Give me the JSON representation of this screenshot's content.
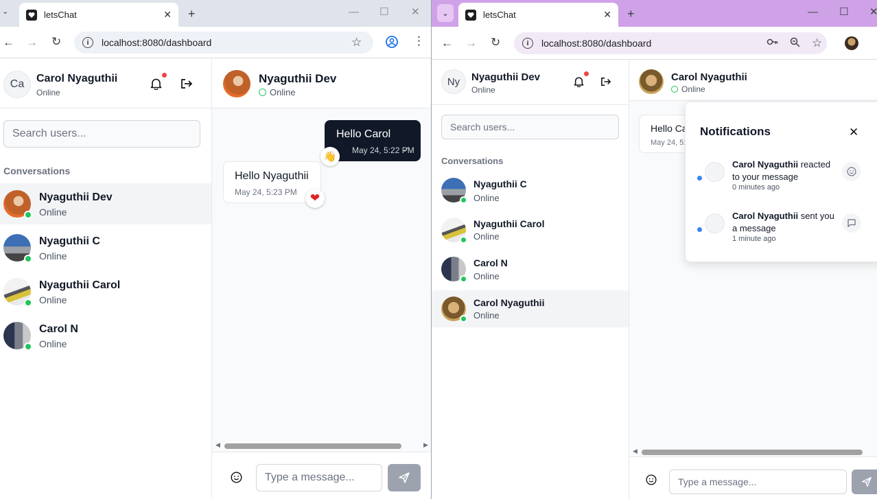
{
  "left_window": {
    "tab_title": "letsChat",
    "url": "localhost:8080/dashboard",
    "current_user": {
      "initials": "Ca",
      "name": "Carol Nyaguthii",
      "status": "Online"
    },
    "search_placeholder": "Search users...",
    "conversations_heading": "Conversations",
    "conversations": [
      {
        "name": "Nyaguthii Dev",
        "status": "Online"
      },
      {
        "name": "Nyaguthii C",
        "status": "Online"
      },
      {
        "name": "Nyaguthii Carol",
        "status": "Online"
      },
      {
        "name": "Carol N",
        "status": "Online"
      }
    ],
    "chat": {
      "name": "Nyaguthii Dev",
      "status": "Online",
      "messages": [
        {
          "text": "Hello Carol",
          "time": "May 24, 5:22 PM",
          "check": "✓",
          "reaction": "👋"
        },
        {
          "text": "Hello Nyaguthii",
          "time": "May 24, 5:23 PM",
          "reaction": "❤"
        }
      ],
      "input_placeholder": "Type a message..."
    }
  },
  "right_window": {
    "tab_title": "letsChat",
    "url": "localhost:8080/dashboard",
    "current_user": {
      "initials": "Ny",
      "name": "Nyaguthii Dev",
      "status": "Online"
    },
    "search_placeholder": "Search users...",
    "conversations_heading": "Conversations",
    "conversations": [
      {
        "name": "Nyaguthii C",
        "status": "Online"
      },
      {
        "name": "Nyaguthii Carol",
        "status": "Online"
      },
      {
        "name": "Carol N",
        "status": "Online"
      },
      {
        "name": "Carol Nyaguthii",
        "status": "Online"
      }
    ],
    "chat": {
      "name": "Carol Nyaguthii",
      "status": "Online",
      "partial_message_text": "Hello Ca",
      "partial_message_time": "May 24, 5:2",
      "input_placeholder": "Type a message..."
    },
    "notifications": {
      "title": "Notifications",
      "items": [
        {
          "user": "Carol Nyaguthii",
          "text": " reacted to your message",
          "time": "0 minutes ago",
          "icon": "smile-icon"
        },
        {
          "user": "Carol Nyaguthii",
          "text": " sent you a message",
          "time": "1 minute ago",
          "icon": "message-icon"
        }
      ]
    }
  },
  "colors": {
    "left_tabstrip": "#dfe3eb",
    "right_tabstrip": "#cfa2e8",
    "online_green": "#22c55e",
    "outgoing_bubble": "#111827",
    "unread_dot": "#3b82f6"
  }
}
